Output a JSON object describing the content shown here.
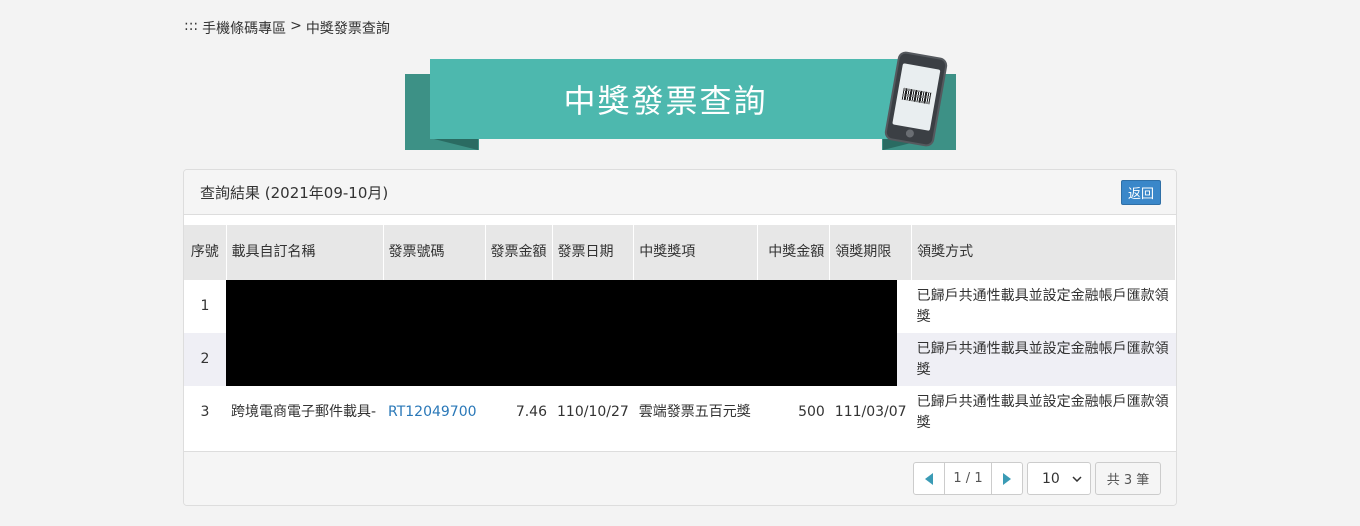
{
  "breadcrumb": {
    "prefix": ":::",
    "items": [
      "手機條碼專區",
      ">",
      "中獎發票查詢"
    ]
  },
  "banner": {
    "title": "中獎發票查詢"
  },
  "panel": {
    "title": "查詢結果 (2021年09-10月)",
    "back_label": "返回"
  },
  "table": {
    "headers": [
      "序號",
      "載具自訂名稱",
      "發票號碼",
      "發票金額",
      "發票日期",
      "中獎獎項",
      "中獎金額",
      "領獎期限",
      "領獎方式"
    ],
    "rows": [
      {
        "no": "1",
        "name": "",
        "invoice": "",
        "amount": "",
        "date": "",
        "prize": "",
        "prize_amount": "",
        "deadline": "",
        "method": "已歸戶共通性載具並設定金融帳戶匯款領獎"
      },
      {
        "no": "2",
        "name": "",
        "invoice": "",
        "amount": "",
        "date": "",
        "prize": "",
        "prize_amount": "",
        "deadline": "",
        "method": "已歸戶共通性載具並設定金融帳戶匯款領獎"
      },
      {
        "no": "3",
        "name": "跨境電商電子郵件載具-",
        "invoice": "RT12049700",
        "amount": "7.46",
        "date": "110/10/27",
        "prize": "雲端發票五百元獎",
        "prize_amount": "500",
        "deadline": "111/03/07",
        "method": "已歸戶共通性載具並設定金融帳戶匯款領獎"
      }
    ]
  },
  "pager": {
    "page_label": "1 / 1",
    "page_size": "10",
    "total_label": "共 3 筆"
  },
  "colors": {
    "accent": "#4db8ae",
    "link": "#2a78b8",
    "button": "#3a87c9"
  }
}
